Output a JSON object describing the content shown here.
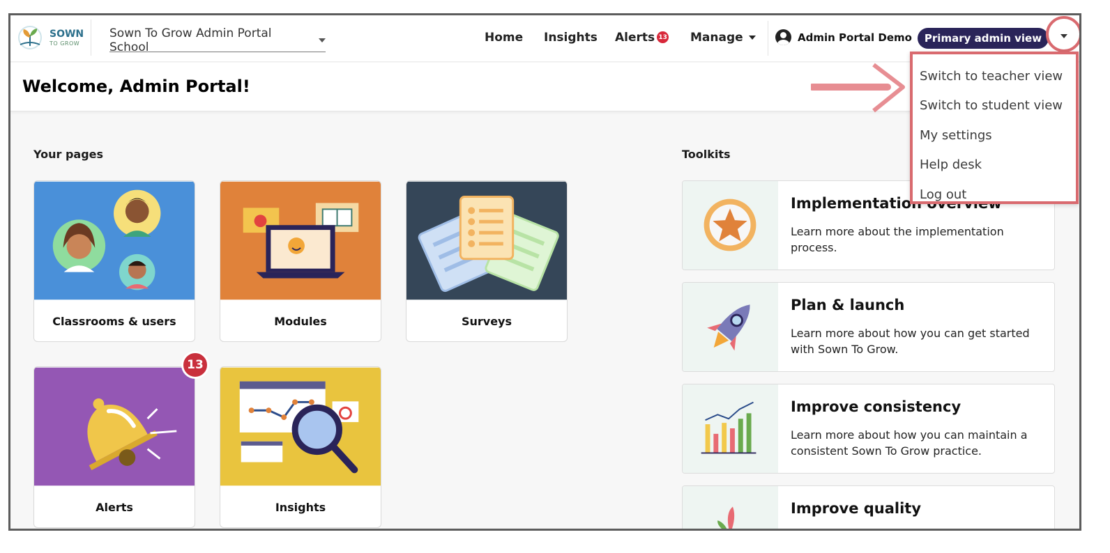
{
  "header": {
    "logo_name": "SOWN",
    "logo_sub": "TO GROW",
    "school": "Sown To Grow Admin Portal School",
    "nav": [
      {
        "label": "Home"
      },
      {
        "label": "Insights"
      },
      {
        "label": "Alerts",
        "badge": "13"
      },
      {
        "label": "Manage"
      }
    ],
    "user_name": "Admin Portal Demo",
    "view_label": "Primary admin view"
  },
  "welcome": {
    "title": "Welcome, Admin Portal!"
  },
  "pages": {
    "title": "Your pages",
    "cards": [
      {
        "label": "Classrooms & users"
      },
      {
        "label": "Modules"
      },
      {
        "label": "Surveys"
      },
      {
        "label": "Alerts",
        "badge": "13"
      },
      {
        "label": "Insights"
      }
    ]
  },
  "toolkits": {
    "title": "Toolkits",
    "items": [
      {
        "title": "Implementation overview",
        "desc": "Learn more about the implementation process."
      },
      {
        "title": "Plan & launch",
        "desc": "Learn more about how you can get started with Sown To Grow."
      },
      {
        "title": "Improve consistency",
        "desc": "Learn more about how you can maintain a consistent Sown To Grow practice."
      },
      {
        "title": "Improve quality",
        "desc": ""
      }
    ]
  },
  "menu": {
    "items": [
      {
        "label": "Switch to teacher view"
      },
      {
        "label": "Switch to student view"
      },
      {
        "label": "My settings"
      },
      {
        "label": "Help desk"
      },
      {
        "label": "Log out"
      }
    ]
  },
  "colors": {
    "brand_navy": "#2a2459",
    "badge_red": "#d8283a",
    "annotation": "#d96a6f",
    "classrooms_bg": "#4a90d9",
    "modules_bg": "#e0823a",
    "surveys_bg": "#354658",
    "alerts_bg": "#9457b4",
    "insights_bg": "#e9c43e"
  }
}
